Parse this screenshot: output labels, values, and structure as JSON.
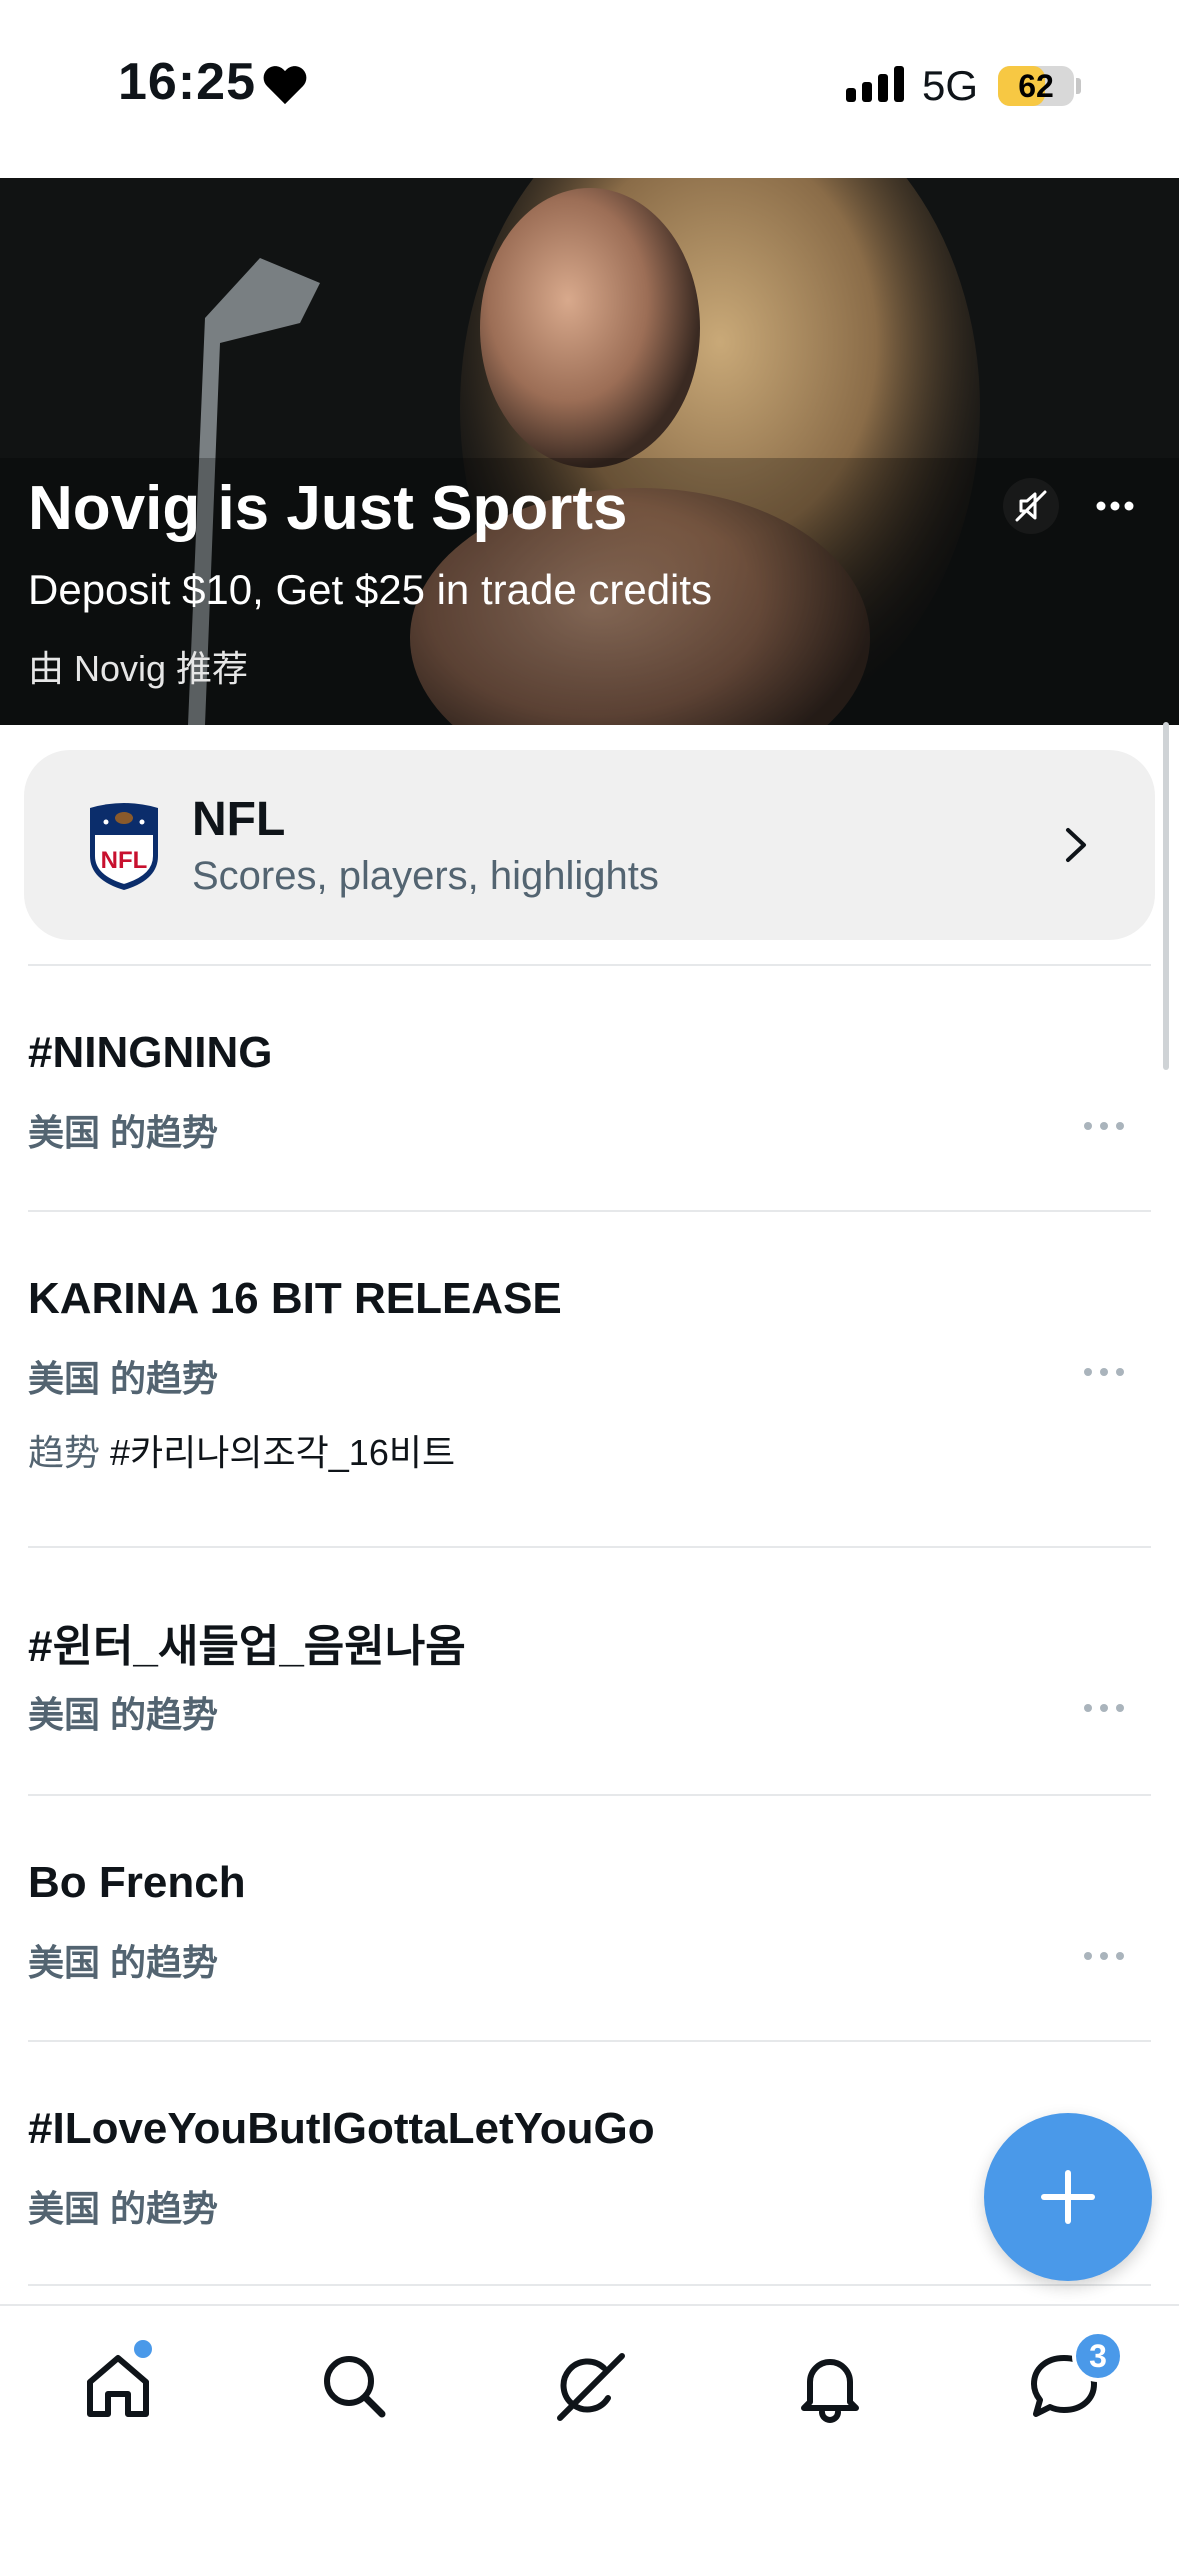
{
  "status_bar": {
    "time": "16:25",
    "network": "5G",
    "battery": "62"
  },
  "promo": {
    "title": "Novig is Just Sports",
    "subtitle": "Deposit $10, Get $25 in trade credits",
    "sponsor": "由 Novig 推荐"
  },
  "nfl_card": {
    "title": "NFL",
    "subtitle": "Scores, players, highlights"
  },
  "trends": [
    {
      "title": "#NINGNING",
      "meta": "美国 的趋势"
    },
    {
      "title": "KARINA 16 BIT RELEASE",
      "meta": "美国 的趋势",
      "extra_label": "趋势",
      "extra_value": "#카리나의조각_16비트"
    },
    {
      "title": "#윈터_새들업_음원나옴",
      "meta": "美国 的趋势"
    },
    {
      "title": "Bo French",
      "meta": "美国 的趋势"
    },
    {
      "title": "#ILoveYouButIGottaLetYouGo",
      "meta": "美国 的趋势"
    }
  ],
  "tabbar": {
    "messages_badge": "3"
  },
  "colors": {
    "accent": "#4a99e9",
    "muted_text": "#536471",
    "card_bg": "#f0f0f0"
  }
}
